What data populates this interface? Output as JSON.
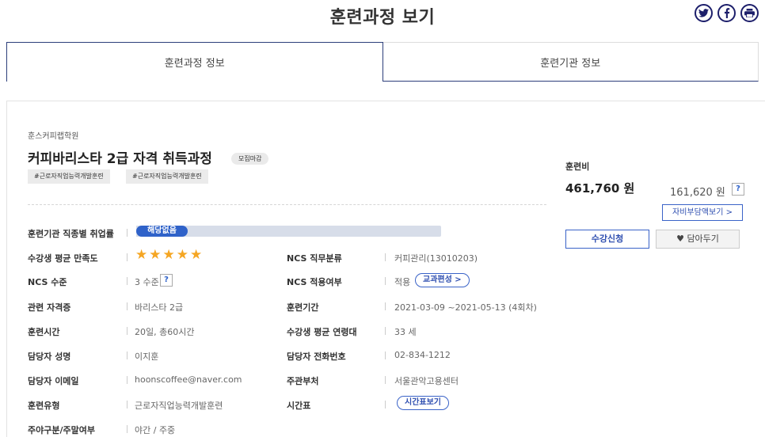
{
  "page": {
    "title": "훈련과정 보기"
  },
  "share": [
    {
      "name": "twitter-icon",
      "glyph": "t"
    },
    {
      "name": "facebook-icon",
      "glyph": "f"
    },
    {
      "name": "print-icon",
      "glyph": "▭"
    }
  ],
  "tabs": [
    {
      "label": "훈련과정 정보",
      "active": true
    },
    {
      "label": "훈련기관 정보",
      "active": false
    }
  ],
  "course": {
    "org": "훈스커피랩학원",
    "title": "커피바리스타 2급 자격 취득과정",
    "status": "모집마감",
    "tags": [
      "#근로자직업능력개발훈련",
      "#근로자직업능력개발훈련"
    ]
  },
  "info": {
    "employment_rate_label": "훈련기관 직종별 취업률",
    "employment_rate_value": "해당없음",
    "satisfaction_label": "수강생 평균 만족도",
    "satisfaction_stars": 5,
    "ncs_job_label": "NCS 직무분류",
    "ncs_job_value": "커피관리(13010203)",
    "ncs_level_label": "NCS 수준",
    "ncs_level_value": "3 수준",
    "ncs_apply_label": "NCS 적용여부",
    "ncs_apply_value": "적용",
    "curriculum_btn": "교과편성 >",
    "cert_label": "관련 자격증",
    "cert_value": "바리스타 2급",
    "period_label": "훈련기간",
    "period_value": "2021-03-09 ~2021-05-13 (4회차)",
    "hours_label": "훈련시간",
    "hours_value": "20일, 총60시간",
    "age_label": "수강생 평균 연령대",
    "age_value": "33 세",
    "manager_label": "담당자 성명",
    "manager_value": "이지훈",
    "phone_label": "담당자 전화번호",
    "phone_value": "02-834-1212",
    "email_label": "담당자 이메일",
    "email_value": "hoonscoffee@naver.com",
    "dept_label": "주관부처",
    "dept_value": "서울관악고용센터",
    "type_label": "훈련유형",
    "type_value": "근로자직업능력개발훈련",
    "timetable_label": "시간표",
    "timetable_btn": "시간표보기",
    "daynight_label": "주야구분/주말여부",
    "daynight_value": "야간 / 주중",
    "qmark": "?"
  },
  "fee": {
    "title": "훈련비",
    "main": "461,760 원",
    "self": "161,620 원",
    "selfpay_btn": "자비부담액보기 >",
    "apply_btn": "수강신청",
    "wish_btn": "담아두기",
    "wish_icon": "♥"
  },
  "colors": {
    "accent": "#2f62c9",
    "navy": "#1d1f6b",
    "star": "#f5a623"
  }
}
